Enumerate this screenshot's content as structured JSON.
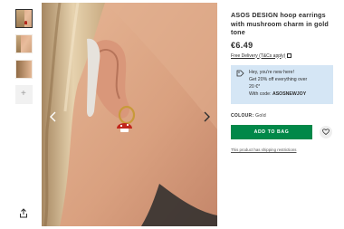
{
  "product": {
    "title": "ASOS DESIGN hoop earrings with mushroom charm in gold tone",
    "price": "€6.49",
    "delivery_link": "Free Delivery (T&Cs apply)",
    "colour_label": "COLOUR:",
    "colour_value": "Gold",
    "restrictions_link": "This product has shipping restrictions"
  },
  "promo": {
    "line1": "Hey, you're new here!",
    "line2": "Get 20% off everything over",
    "line3": "20 €*",
    "code_prefix": "With code:",
    "code": "ASOSNEWJOY",
    "background": "#d5e6f5"
  },
  "buttons": {
    "add_to_bag": "ADD TO BAG",
    "add_to_bag_color": "#018849"
  },
  "icons": {
    "share": "share-icon",
    "prev": "chevron-left-icon",
    "next": "chevron-right-icon",
    "tag": "tag-icon",
    "heart": "heart-icon",
    "external": "external-link-icon"
  },
  "thumbnails": {
    "count": 4,
    "active": 1
  }
}
